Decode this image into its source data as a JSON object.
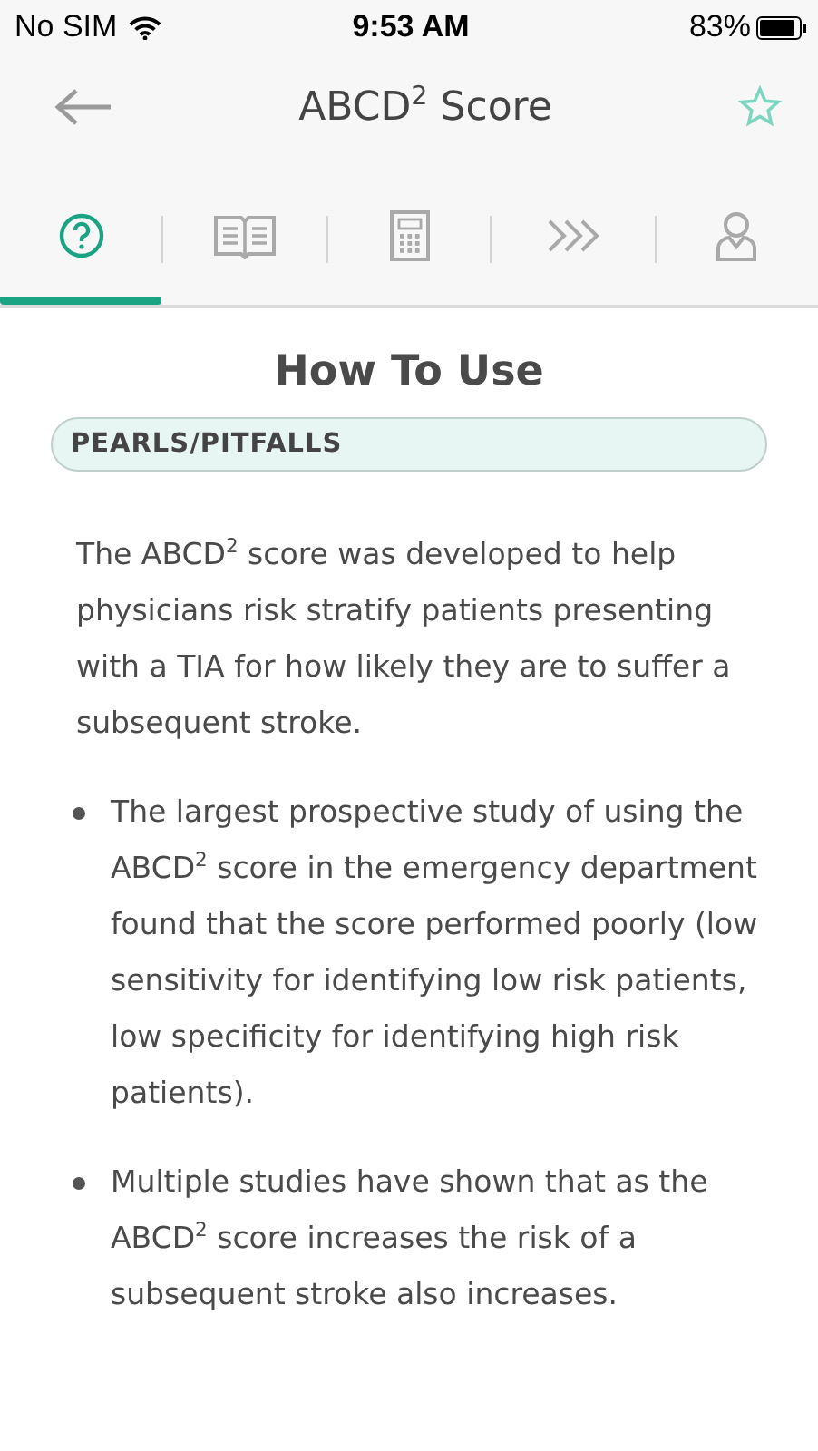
{
  "status_bar": {
    "carrier": "No SIM",
    "time": "9:53 AM",
    "battery": "83%"
  },
  "nav": {
    "title": "ABCD$^{2}$ Score",
    "favorite": false
  },
  "tabs": [
    {
      "kind": "help",
      "selected": true
    },
    {
      "kind": "book",
      "selected": false
    },
    {
      "kind": "calculator",
      "selected": false
    },
    {
      "kind": "next-steps",
      "selected": false
    },
    {
      "kind": "person",
      "selected": false
    }
  ],
  "section_title": "How To Use",
  "section_pill": "PEARLS/PITFALLS",
  "intro": "The ABCD$^{2}$ score was developed to help physicians risk stratify patients presenting with a TIA for how likely they are to suffer a subsequent stroke.",
  "bullets": [
    "The largest prospective study of using the ABCD$^{2}$ score in the emergency department found that the score performed poorly (low sensitivity for identifying low risk patients, low specificity for identifying high risk patients).",
    "Multiple studies have shown that as the ABCD$^{2}$ score increases the risk of a subsequent stroke also increases."
  ]
}
